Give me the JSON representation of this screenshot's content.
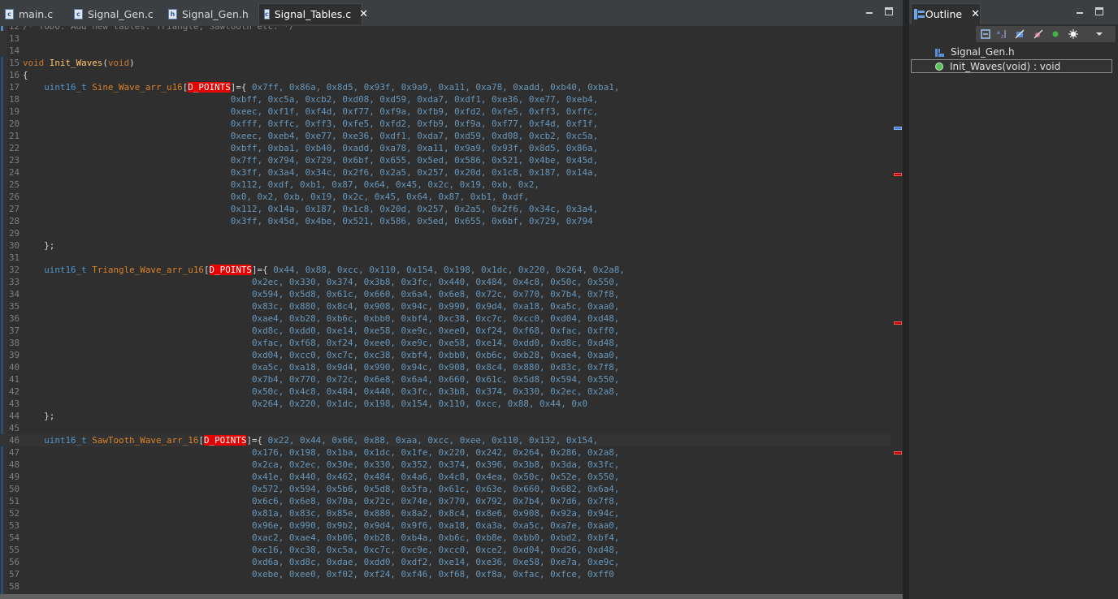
{
  "editor": {
    "tabs": [
      {
        "label": "main.c",
        "type": "c"
      },
      {
        "label": "Signal_Gen.c",
        "type": "c"
      },
      {
        "label": "Signal_Gen.h",
        "type": "h"
      },
      {
        "label": "Signal_Tables.c",
        "type": "c",
        "active": true,
        "close": "✕"
      }
    ],
    "current_line": 46,
    "lines": [
      {
        "n": "12",
        "t": [
          [
            "cm",
            "/* TODO: Add new tables: Triangle, Sawtooth etc. */"
          ]
        ]
      },
      {
        "n": "13",
        "t": []
      },
      {
        "n": "14",
        "t": []
      },
      {
        "n": "15",
        "t": [
          [
            "kw",
            "void"
          ],
          [
            "pun",
            " "
          ],
          [
            "fn",
            "Init_Waves"
          ],
          [
            "pun",
            "("
          ],
          [
            "kw",
            "void"
          ],
          [
            "pun",
            ")"
          ]
        ]
      },
      {
        "n": "16",
        "t": [
          [
            "pun",
            "{"
          ]
        ]
      },
      {
        "n": "17",
        "t": [
          [
            "pun",
            "    "
          ],
          [
            "ty",
            "uint16_t"
          ],
          [
            "pun",
            " "
          ],
          [
            "id",
            "Sine_Wave_arr_u16"
          ],
          [
            "pun",
            "["
          ],
          [
            "mac",
            "D_POINTS"
          ],
          [
            "pun",
            "]={ "
          ],
          [
            "hx",
            "0x7ff, 0x86a, 0x8d5, 0x93f, 0x9a9, 0xa11, 0xa78, 0xadd, 0xb40, 0xba1,"
          ]
        ]
      },
      {
        "n": "18",
        "t": [
          [
            "pun",
            "                                       "
          ],
          [
            "hx",
            "0xbff, 0xc5a, 0xcb2, 0xd08, 0xd59, 0xda7, 0xdf1, 0xe36, 0xe77, 0xeb4,"
          ]
        ]
      },
      {
        "n": "19",
        "t": [
          [
            "pun",
            "                                       "
          ],
          [
            "hx",
            "0xeec, 0xf1f, 0xf4d, 0xf77, 0xf9a, 0xfb9, 0xfd2, 0xfe5, 0xff3, 0xffc,"
          ]
        ]
      },
      {
        "n": "20",
        "t": [
          [
            "pun",
            "                                       "
          ],
          [
            "hx",
            "0xfff, 0xffc, 0xff3, 0xfe5, 0xfd2, 0xfb9, 0xf9a, 0xf77, 0xf4d, 0xf1f,"
          ]
        ]
      },
      {
        "n": "21",
        "t": [
          [
            "pun",
            "                                       "
          ],
          [
            "hx",
            "0xeec, 0xeb4, 0xe77, 0xe36, 0xdf1, 0xda7, 0xd59, 0xd08, 0xcb2, 0xc5a,"
          ]
        ]
      },
      {
        "n": "22",
        "t": [
          [
            "pun",
            "                                       "
          ],
          [
            "hx",
            "0xbff, 0xba1, 0xb40, 0xadd, 0xa78, 0xa11, 0x9a9, 0x93f, 0x8d5, 0x86a,"
          ]
        ]
      },
      {
        "n": "23",
        "t": [
          [
            "pun",
            "                                       "
          ],
          [
            "hx",
            "0x7ff, 0x794, 0x729, 0x6bf, 0x655, 0x5ed, 0x586, 0x521, 0x4be, 0x45d,"
          ]
        ]
      },
      {
        "n": "24",
        "t": [
          [
            "pun",
            "                                       "
          ],
          [
            "hx",
            "0x3ff, 0x3a4, 0x34c, 0x2f6, 0x2a5, 0x257, 0x20d, 0x1c8, 0x187, 0x14a,"
          ]
        ]
      },
      {
        "n": "25",
        "t": [
          [
            "pun",
            "                                       "
          ],
          [
            "hx",
            "0x112, 0xdf, 0xb1, 0x87, 0x64, 0x45, 0x2c, 0x19, 0xb, 0x2,"
          ]
        ]
      },
      {
        "n": "26",
        "t": [
          [
            "pun",
            "                                       "
          ],
          [
            "hx",
            "0x0, 0x2, 0xb, 0x19, 0x2c, 0x45, 0x64, 0x87, 0xb1, 0xdf,"
          ]
        ]
      },
      {
        "n": "27",
        "t": [
          [
            "pun",
            "                                       "
          ],
          [
            "hx",
            "0x112, 0x14a, 0x187, 0x1c8, 0x20d, 0x257, 0x2a5, 0x2f6, 0x34c, 0x3a4,"
          ]
        ]
      },
      {
        "n": "28",
        "t": [
          [
            "pun",
            "                                       "
          ],
          [
            "hx",
            "0x3ff, 0x45d, 0x4be, 0x521, 0x586, 0x5ed, 0x655, 0x6bf, 0x729, 0x794"
          ]
        ]
      },
      {
        "n": "29",
        "t": []
      },
      {
        "n": "30",
        "t": [
          [
            "pun",
            "    };"
          ]
        ]
      },
      {
        "n": "31",
        "t": []
      },
      {
        "n": "32",
        "t": [
          [
            "pun",
            "    "
          ],
          [
            "ty",
            "uint16_t"
          ],
          [
            "pun",
            " "
          ],
          [
            "id",
            "Triangle_Wave_arr_u16"
          ],
          [
            "pun",
            "["
          ],
          [
            "mac",
            "D_POINTS"
          ],
          [
            "pun",
            "]={ "
          ],
          [
            "hx",
            "0x44, 0x88, 0xcc, 0x110, 0x154, 0x198, 0x1dc, 0x220, 0x264, 0x2a8,"
          ]
        ]
      },
      {
        "n": "33",
        "t": [
          [
            "pun",
            "                                           "
          ],
          [
            "hx",
            "0x2ec, 0x330, 0x374, 0x3b8, 0x3fc, 0x440, 0x484, 0x4c8, 0x50c, 0x550,"
          ]
        ]
      },
      {
        "n": "34",
        "t": [
          [
            "pun",
            "                                           "
          ],
          [
            "hx",
            "0x594, 0x5d8, 0x61c, 0x660, 0x6a4, 0x6e8, 0x72c, 0x770, 0x7b4, 0x7f8,"
          ]
        ]
      },
      {
        "n": "35",
        "t": [
          [
            "pun",
            "                                           "
          ],
          [
            "hx",
            "0x83c, 0x880, 0x8c4, 0x908, 0x94c, 0x990, 0x9d4, 0xa18, 0xa5c, 0xaa0,"
          ]
        ]
      },
      {
        "n": "36",
        "t": [
          [
            "pun",
            "                                           "
          ],
          [
            "hx",
            "0xae4, 0xb28, 0xb6c, 0xbb0, 0xbf4, 0xc38, 0xc7c, 0xcc0, 0xd04, 0xd48,"
          ]
        ]
      },
      {
        "n": "37",
        "t": [
          [
            "pun",
            "                                           "
          ],
          [
            "hx",
            "0xd8c, 0xdd0, 0xe14, 0xe58, 0xe9c, 0xee0, 0xf24, 0xf68, 0xfac, 0xff0,"
          ]
        ]
      },
      {
        "n": "38",
        "t": [
          [
            "pun",
            "                                           "
          ],
          [
            "hx",
            "0xfac, 0xf68, 0xf24, 0xee0, 0xe9c, 0xe58, 0xe14, 0xdd0, 0xd8c, 0xd48,"
          ]
        ]
      },
      {
        "n": "39",
        "t": [
          [
            "pun",
            "                                           "
          ],
          [
            "hx",
            "0xd04, 0xcc0, 0xc7c, 0xc38, 0xbf4, 0xbb0, 0xb6c, 0xb28, 0xae4, 0xaa0,"
          ]
        ]
      },
      {
        "n": "40",
        "t": [
          [
            "pun",
            "                                           "
          ],
          [
            "hx",
            "0xa5c, 0xa18, 0x9d4, 0x990, 0x94c, 0x908, 0x8c4, 0x880, 0x83c, 0x7f8,"
          ]
        ]
      },
      {
        "n": "41",
        "t": [
          [
            "pun",
            "                                           "
          ],
          [
            "hx",
            "0x7b4, 0x770, 0x72c, 0x6e8, 0x6a4, 0x660, 0x61c, 0x5d8, 0x594, 0x550,"
          ]
        ]
      },
      {
        "n": "42",
        "t": [
          [
            "pun",
            "                                           "
          ],
          [
            "hx",
            "0x50c, 0x4c8, 0x484, 0x440, 0x3fc, 0x3b8, 0x374, 0x330, 0x2ec, 0x2a8,"
          ]
        ]
      },
      {
        "n": "43",
        "t": [
          [
            "pun",
            "                                           "
          ],
          [
            "hx",
            "0x264, 0x220, 0x1dc, 0x198, 0x154, 0x110, 0xcc, 0x88, 0x44, 0x0"
          ]
        ]
      },
      {
        "n": "44",
        "t": [
          [
            "pun",
            "    };"
          ]
        ]
      },
      {
        "n": "45",
        "t": []
      },
      {
        "n": "46",
        "t": [
          [
            "pun",
            "    "
          ],
          [
            "ty",
            "uint16_t"
          ],
          [
            "pun",
            " "
          ],
          [
            "id",
            "SawTooth_Wave_arr_16"
          ],
          [
            "pun",
            "["
          ],
          [
            "mac",
            "D_POINTS"
          ],
          [
            "pun",
            "]={ "
          ],
          [
            "hx",
            "0x22, 0x44, 0x66, 0x88, 0xaa, 0xcc, 0xee, 0x110, 0x132, 0x154,"
          ]
        ]
      },
      {
        "n": "47",
        "t": [
          [
            "pun",
            "                                           "
          ],
          [
            "hx",
            "0x176, 0x198, 0x1ba, 0x1dc, 0x1fe, 0x220, 0x242, 0x264, 0x286, 0x2a8,"
          ]
        ]
      },
      {
        "n": "48",
        "t": [
          [
            "pun",
            "                                           "
          ],
          [
            "hx",
            "0x2ca, 0x2ec, 0x30e, 0x330, 0x352, 0x374, 0x396, 0x3b8, 0x3da, 0x3fc,"
          ]
        ]
      },
      {
        "n": "49",
        "t": [
          [
            "pun",
            "                                           "
          ],
          [
            "hx",
            "0x41e, 0x440, 0x462, 0x484, 0x4a6, 0x4c8, 0x4ea, 0x50c, 0x52e, 0x550,"
          ]
        ]
      },
      {
        "n": "50",
        "t": [
          [
            "pun",
            "                                           "
          ],
          [
            "hx",
            "0x572, 0x594, 0x5b6, 0x5d8, 0x5fa, 0x61c, 0x63e, 0x660, 0x682, 0x6a4,"
          ]
        ]
      },
      {
        "n": "51",
        "t": [
          [
            "pun",
            "                                           "
          ],
          [
            "hx",
            "0x6c6, 0x6e8, 0x70a, 0x72c, 0x74e, 0x770, 0x792, 0x7b4, 0x7d6, 0x7f8,"
          ]
        ]
      },
      {
        "n": "52",
        "t": [
          [
            "pun",
            "                                           "
          ],
          [
            "hx",
            "0x81a, 0x83c, 0x85e, 0x880, 0x8a2, 0x8c4, 0x8e6, 0x908, 0x92a, 0x94c,"
          ]
        ]
      },
      {
        "n": "53",
        "t": [
          [
            "pun",
            "                                           "
          ],
          [
            "hx",
            "0x96e, 0x990, 0x9b2, 0x9d4, 0x9f6, 0xa18, 0xa3a, 0xa5c, 0xa7e, 0xaa0,"
          ]
        ]
      },
      {
        "n": "54",
        "t": [
          [
            "pun",
            "                                           "
          ],
          [
            "hx",
            "0xac2, 0xae4, 0xb06, 0xb28, 0xb4a, 0xb6c, 0xb8e, 0xbb0, 0xbd2, 0xbf4,"
          ]
        ]
      },
      {
        "n": "55",
        "t": [
          [
            "pun",
            "                                           "
          ],
          [
            "hx",
            "0xc16, 0xc38, 0xc5a, 0xc7c, 0xc9e, 0xcc0, 0xce2, 0xd04, 0xd26, 0xd48,"
          ]
        ]
      },
      {
        "n": "56",
        "t": [
          [
            "pun",
            "                                           "
          ],
          [
            "hx",
            "0xd6a, 0xd8c, 0xdae, 0xdd0, 0xdf2, 0xe14, 0xe36, 0xe58, 0xe7a, 0xe9c,"
          ]
        ]
      },
      {
        "n": "57",
        "t": [
          [
            "pun",
            "                                           "
          ],
          [
            "hx",
            "0xebe, 0xee0, 0xf02, 0xf24, 0xf46, 0xf68, 0xf8a, 0xfac, 0xfce, 0xff0"
          ]
        ]
      },
      {
        "n": "58",
        "t": []
      }
    ]
  },
  "outline": {
    "tab_label": "Outline",
    "close": "✕",
    "items": [
      {
        "label": "Signal_Gen.h",
        "kind": "header"
      },
      {
        "label": "Init_Waves(void) : void",
        "kind": "function",
        "selected": true
      }
    ]
  },
  "colors": {
    "macro_bg": "#e60000",
    "hex": "#6897bb",
    "type": "#4f96cc",
    "identifier": "#d9822b"
  }
}
